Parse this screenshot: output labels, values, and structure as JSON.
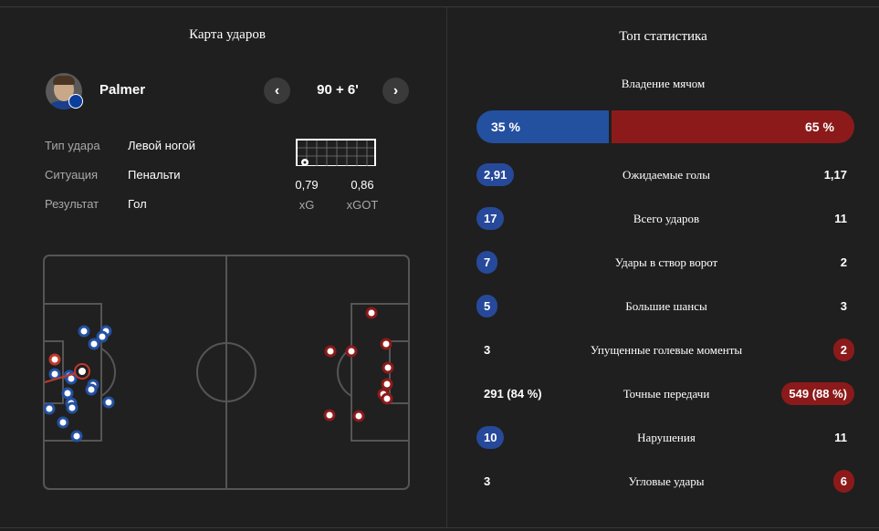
{
  "left": {
    "title": "Карта ударов",
    "player": {
      "name": "Palmer",
      "minute": "90 + 6'",
      "prev_icon": "‹",
      "next_icon": "›"
    },
    "details": [
      {
        "label": "Тип удара",
        "value": "Левой ногой"
      },
      {
        "label": "Ситуация",
        "value": "Пенальти"
      },
      {
        "label": "Результат",
        "value": "Гол"
      }
    ],
    "xg": {
      "value": "0,79",
      "label": "xG"
    },
    "xgot": {
      "value": "0,86",
      "label": "xGOT"
    }
  },
  "right": {
    "title": "Топ статистика",
    "possession": {
      "title": "Владение мячом",
      "home": "35 %",
      "away": "65 %",
      "home_share": 0.35
    },
    "stats": [
      {
        "label": "Ожидаемые голы",
        "home": "2,91",
        "away": "1,17",
        "home_pill": true,
        "away_pill": false
      },
      {
        "label": "Всего ударов",
        "home": "17",
        "away": "11",
        "home_pill": true,
        "away_pill": false
      },
      {
        "label": "Удары в створ ворот",
        "home": "7",
        "away": "2",
        "home_pill": true,
        "away_pill": false
      },
      {
        "label": "Большие шансы",
        "home": "5",
        "away": "3",
        "home_pill": true,
        "away_pill": false
      },
      {
        "label": "Упущенные голевые моменты",
        "home": "3",
        "away": "2",
        "home_pill": false,
        "away_pill": true
      },
      {
        "label": "Точные передачи",
        "home": "291 (84 %)",
        "away": "549 (88 %)",
        "home_pill": false,
        "away_pill": true
      },
      {
        "label": "Нарушения",
        "home": "10",
        "away": "11",
        "home_pill": true,
        "away_pill": false
      },
      {
        "label": "Угловые удары",
        "home": "3",
        "away": "6",
        "home_pill": false,
        "away_pill": true
      }
    ]
  },
  "colors": {
    "home": "#2450a0",
    "away": "#8c1a1a",
    "background": "#1f1f1f",
    "pitch": "#202020"
  }
}
